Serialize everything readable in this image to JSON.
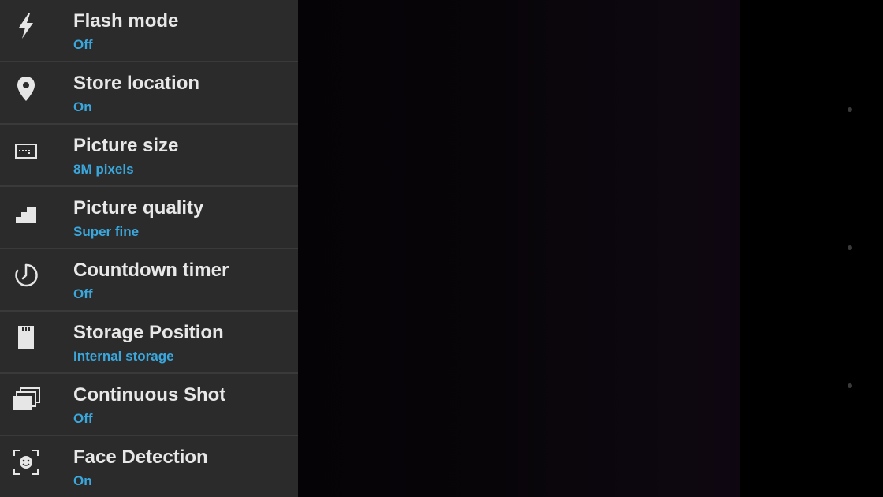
{
  "settings": [
    {
      "icon": "flash-icon",
      "title": "Flash mode",
      "value": "Off"
    },
    {
      "icon": "location-pin-icon",
      "title": "Store location",
      "value": "On"
    },
    {
      "icon": "picture-size-icon",
      "title": "Picture size",
      "value": "8M pixels"
    },
    {
      "icon": "quality-stairs-icon",
      "title": "Picture quality",
      "value": "Super fine"
    },
    {
      "icon": "timer-icon",
      "title": "Countdown timer",
      "value": "Off"
    },
    {
      "icon": "sd-card-icon",
      "title": "Storage Position",
      "value": "Internal storage"
    },
    {
      "icon": "burst-shot-icon",
      "title": "Continuous Shot",
      "value": "Off"
    },
    {
      "icon": "face-detection-icon",
      "title": "Face Detection",
      "value": "On"
    }
  ],
  "colors": {
    "panel_background": "#2b2b2b",
    "divider": "#3a3a3a",
    "title_text": "#e8e8e8",
    "value_accent": "#3aa7dd",
    "viewfinder": "#0a060c"
  }
}
